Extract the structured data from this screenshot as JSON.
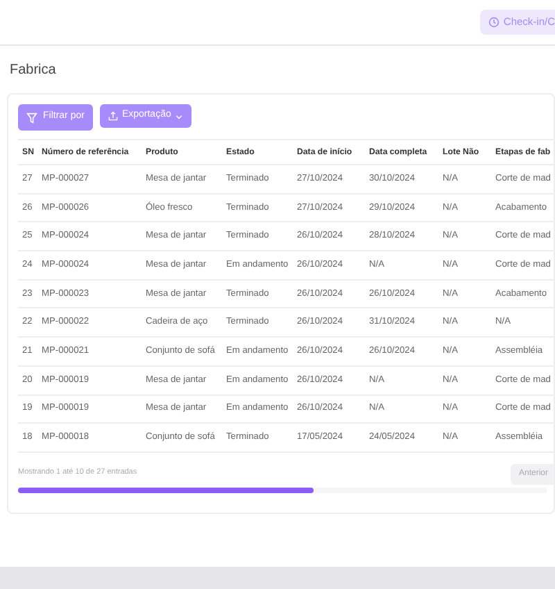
{
  "header": {
    "checkin_button": "Check-in/C"
  },
  "page_title": "Fabrica",
  "toolbar": {
    "filter_button": "Filtrar por",
    "export_button": "Exportação"
  },
  "table": {
    "columns": [
      "SN",
      "Número de referência",
      "Produto",
      "Estado",
      "Data de início",
      "Data completa",
      "Lote Não",
      "Etapas de fab"
    ],
    "rows": [
      [
        "27",
        "MP-000027",
        "Mesa de jantar",
        "Terminado",
        "27/10/2024",
        "30/10/2024",
        "N/A",
        "Corte de mad"
      ],
      [
        "26",
        "MP-000026",
        "Óleo fresco",
        "Terminado",
        "27/10/2024",
        "29/10/2024",
        "N/A",
        "Acabamento"
      ],
      [
        "25",
        "MP-000024",
        "Mesa de jantar",
        "Terminado",
        "26/10/2024",
        "28/10/2024",
        "N/A",
        "Corte de mad"
      ],
      [
        "24",
        "MP-000024",
        "Mesa de jantar",
        "Em andamento",
        "26/10/2024",
        "N/A",
        "N/A",
        "Corte de mad"
      ],
      [
        "23",
        "MP-000023",
        "Mesa de jantar",
        "Terminado",
        "26/10/2024",
        "26/10/2024",
        "N/A",
        "Acabamento"
      ],
      [
        "22",
        "MP-000022",
        "Cadeira de aço",
        "Terminado",
        "26/10/2024",
        "31/10/2024",
        "N/A",
        "N/A"
      ],
      [
        "21",
        "MP-000021",
        "Conjunto de sofá",
        "Em andamento",
        "26/10/2024",
        "26/10/2024",
        "N/A",
        "Assembléia"
      ],
      [
        "20",
        "MP-000019",
        "Mesa de jantar",
        "Em andamento",
        "26/10/2024",
        "N/A",
        "N/A",
        "Corte de mad"
      ],
      [
        "19",
        "MP-000019",
        "Mesa de jantar",
        "Em andamento",
        "26/10/2024",
        "N/A",
        "N/A",
        "Corte de mad"
      ],
      [
        "18",
        "MP-000018",
        "Conjunto de sofá",
        "Terminado",
        "17/05/2024",
        "24/05/2024",
        "N/A",
        "Assembléia"
      ]
    ]
  },
  "footer": {
    "info": "Mostrando 1 até 10 de 27 entradas",
    "prev_button": "Anterior"
  }
}
